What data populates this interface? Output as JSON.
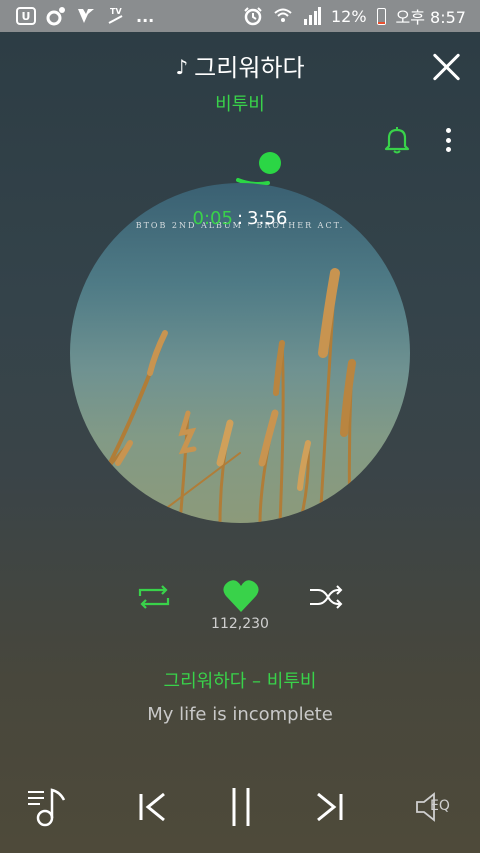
{
  "status_bar": {
    "left_icons": [
      "app-u-icon",
      "music-note-icon",
      "v-app-icon",
      "tv-icon"
    ],
    "more_label": "...",
    "battery_percent_label": "12%",
    "time": "오후 8:57",
    "battery_level": 0.12,
    "right_icons": [
      "alarm-icon",
      "wifi-icon",
      "signal-icon",
      "battery-icon"
    ]
  },
  "header": {
    "note_glyph": "♪",
    "song_title": "그리워하다",
    "artist": "비투비"
  },
  "player": {
    "album_caption": "BTOB 2ND ALBUM · BROTHER ACT.",
    "elapsed": "0:05",
    "separator": ":",
    "total": "3:56",
    "progress_fraction": 0.021,
    "likes": "112,230"
  },
  "lyrics": {
    "title_line": "그리워하다 – 비투비",
    "current_line": "My life is incomplete"
  },
  "controls": {
    "eq_label": "EQ"
  },
  "colors": {
    "accent": "#39d24a",
    "status_bar_bg": "#8a8d8f",
    "battery_low": "#e8502f"
  }
}
